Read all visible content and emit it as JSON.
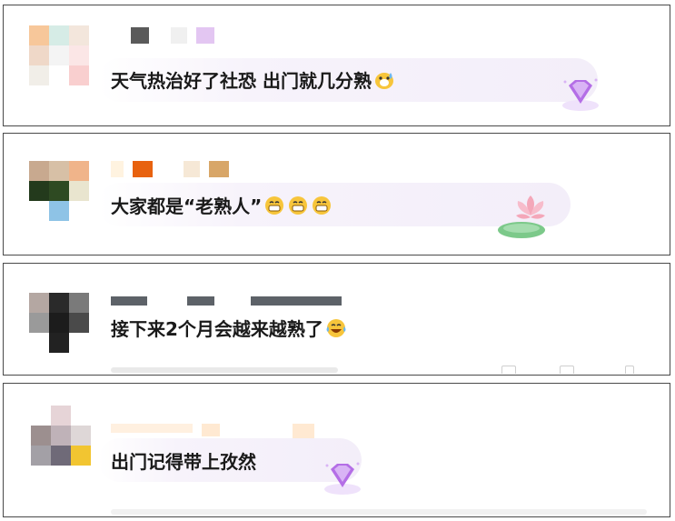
{
  "comments": [
    {
      "text": "天气热治好了社恐 出门就几分熟",
      "emoji": "face-with-sweat-emoji",
      "badge": "diamond-badge-icon"
    },
    {
      "text": "大家都是“老熟人”",
      "emoji": "grinning-face-emoji",
      "badge": "lotus-badge-icon"
    },
    {
      "text": "接下来2个月会越来越熟了",
      "emoji": "laughing-tears-emoji",
      "badge": ""
    },
    {
      "text": "出门记得带上孜然",
      "emoji": "",
      "badge": "diamond-badge-icon"
    }
  ],
  "colors": {
    "border": "#4a4a4a",
    "text": "#1a1a1a",
    "bubble": "#f3eef9",
    "badge_purple": "#b46ee6",
    "lotus_pink": "#f4a7b9",
    "leaf_green": "#7cc98a"
  }
}
